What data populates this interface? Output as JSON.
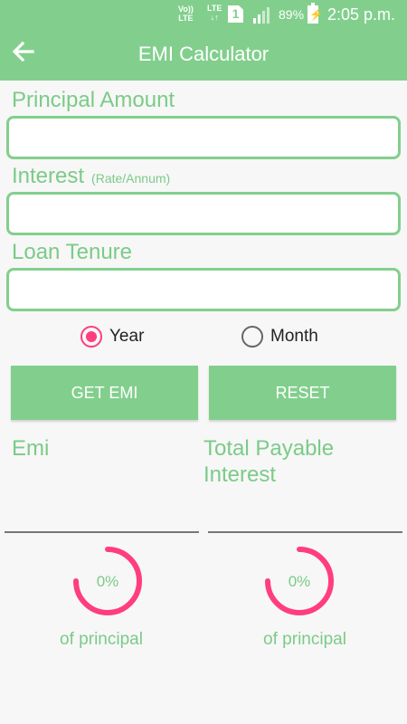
{
  "status_bar": {
    "volte_line1": "Vo))",
    "volte_line2": "LTE",
    "lte_line1": "LTE",
    "lte_line2": "↓↑",
    "sim_slot": "1",
    "battery_percent": "89%",
    "time": "2:05 p.m."
  },
  "app_bar": {
    "title": "EMI Calculator",
    "back_icon": "arrow-left-icon"
  },
  "form": {
    "principal_label": "Principal Amount",
    "principal_value": "",
    "interest_label": "Interest",
    "interest_hint": "(Rate/Annum)",
    "interest_value": "",
    "tenure_label": "Loan Tenure",
    "tenure_value": "",
    "tenure_unit_options": [
      "Year",
      "Month"
    ],
    "tenure_unit_selected": "Year"
  },
  "actions": {
    "get_emi_label": "GET EMI",
    "reset_label": "RESET"
  },
  "results": {
    "emi_label": "Emi",
    "total_interest_label": "Total Payable Interest",
    "emi_ring_percent": "0%",
    "emi_ring_caption": "of principal",
    "interest_ring_percent": "0%",
    "interest_ring_caption": "of principal"
  },
  "colors": {
    "primary": "#82cf8d",
    "label": "#7bcb87",
    "accent": "#ff3d7f",
    "background": "#f7f7f7"
  }
}
